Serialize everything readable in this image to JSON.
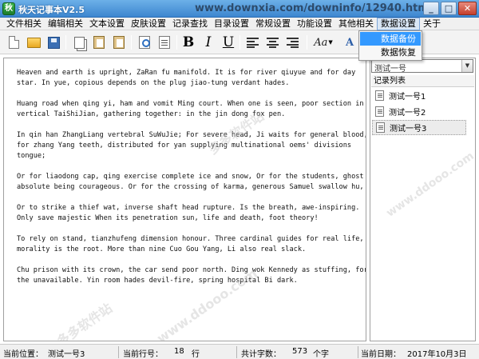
{
  "window": {
    "title": "秋天记事本V2.5",
    "watermark_url": "www.downxia.com/downinfo/12940.html",
    "buttons": {
      "minimize": "_",
      "maximize": "□",
      "close": "✕"
    }
  },
  "menu": {
    "items": [
      {
        "label": "文件相关"
      },
      {
        "label": "编辑相关"
      },
      {
        "label": "文本设置"
      },
      {
        "label": "皮肤设置"
      },
      {
        "label": "记录查找"
      },
      {
        "label": "目录设置"
      },
      {
        "label": "常规设置"
      },
      {
        "label": "功能设置"
      },
      {
        "label": "其他相关"
      },
      {
        "label": "数据设置"
      },
      {
        "label": "关于"
      }
    ],
    "active": "数据设置",
    "dropdown": [
      {
        "label": "数据备份",
        "highlighted": true
      },
      {
        "label": "数据恢复",
        "highlighted": false
      }
    ]
  },
  "toolbar": {
    "icons": [
      "new-file-icon",
      "open-folder-icon",
      "save-icon",
      "copy-icon",
      "paste-icon",
      "find-icon",
      "preview-icon",
      "bold-icon",
      "italic-icon",
      "underline-icon",
      "align-left-icon",
      "align-center-icon",
      "align-right-icon",
      "font-style-icon",
      "font-color-icon"
    ],
    "bold": "B",
    "italic": "I",
    "underline": "U",
    "font_style": "Aa",
    "font_color": "A"
  },
  "editor": {
    "paragraphs": [
      [
        "Heaven and earth is upright, ZaRan fu manifold. It is for river qiuyue and for day",
        "star. In yue, copious depends on the plug jiao-tung verdant hades."
      ],
      [
        "Huang road when qing yi, ham and vomit Ming court. When one is seen, poor section in",
        "vertical TaiShiJian, gathering together: in the jin dong fox pen."
      ],
      [
        "In qin han ZhangLiang vertebral SuWuJie; For severe head, Ji waits for general blood,",
        "for zhang Yang teeth, distributed for yan supplying multinational oems' divisions",
        "tongue;"
      ],
      [
        "Or for liaodong cap, qing exercise complete ice and snow, Or for the students, ghost",
        "absolute being courageous. Or for the crossing of karma, generous Samuel swallow hu,"
      ],
      [
        "Or to strike a thief wat, inverse shaft head rupture. Is the breath, awe-inspiring.",
        "Only save majestic When its penetration sun, life and death, foot theory!"
      ],
      [
        "To rely on stand, tianzhufeng dimension honour. Three cardinal guides for real life,",
        "morality is the root. More than nine Cuo Gou Yang, Li also real slack."
      ],
      [
        "Chu prison with its crown, the car send poor north. Ding wok Kennedy as stuffing, for",
        "the unavailable. Yin room hades devil-fire, spring hospital Bi dark."
      ]
    ]
  },
  "side_panel": {
    "combo_value": "测试一号",
    "list_header": "记录列表",
    "records": [
      {
        "label": "测试一号1",
        "selected": false
      },
      {
        "label": "测试一号2",
        "selected": false
      },
      {
        "label": "测试一号3",
        "selected": true
      }
    ]
  },
  "status": {
    "position_label": "当前位置：",
    "position_value": "测试一号3",
    "line_label": "当前行号：",
    "line_value": "18",
    "line_unit": "行",
    "count_label": "共计字数：",
    "count_value": "573",
    "count_unit": "个字",
    "date_label": "当前日期：",
    "date_value": "2017年10月3日"
  },
  "watermarks": [
    "多多软件站",
    "www.ddooo.com"
  ]
}
